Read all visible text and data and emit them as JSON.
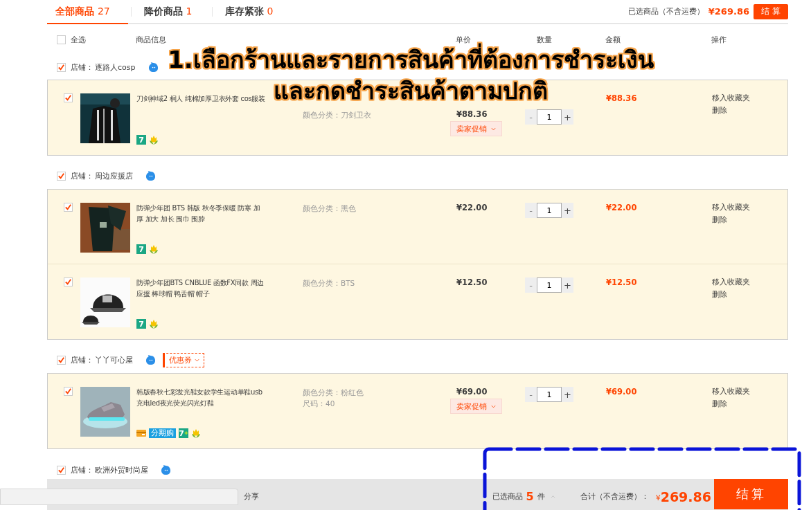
{
  "tabs": [
    {
      "label": "全部商品",
      "count": "27",
      "selected": true
    },
    {
      "label": "降价商品",
      "count": "1",
      "selected": false
    },
    {
      "label": "库存紧张",
      "count": "0",
      "selected": false
    }
  ],
  "top_summary": {
    "label": "已选商品（不含运费）",
    "total": "¥269.86",
    "button": "结 算"
  },
  "header": {
    "select_all": {
      "label": "全选",
      "checked": false
    },
    "columns": [
      "商品信息",
      "单价",
      "数量",
      "金额",
      "操作"
    ]
  },
  "shops": [
    {
      "label": "店铺：",
      "name": "逐路人cosp",
      "checked": true,
      "items": [
        {
          "checked": true,
          "title": "刀剑神域2 桐人 纯棉加厚卫衣外套 cos服装",
          "props": [
            "颜色分类：刀剑卫衣"
          ],
          "price": "¥88.36",
          "promo": "卖家促销",
          "qty": {
            "minus": "-",
            "value": "1",
            "plus": "+"
          },
          "amount": "¥88.36",
          "actions": [
            "移入收藏夹",
            "删除"
          ],
          "badges": [
            {
              "kind": "seven",
              "text": "7"
            },
            {
              "kind": "flower"
            }
          ]
        }
      ]
    },
    {
      "label": "店铺：",
      "name": "周边应援店",
      "checked": true,
      "items": [
        {
          "checked": true,
          "title": "防弹少年团 BTS 韩版 秋冬季保暖 防寒 加厚 加大 加长 围巾 围脖",
          "props": [
            "颜色分类：黑色"
          ],
          "price": "¥22.00",
          "qty": {
            "minus": "-",
            "value": "1",
            "plus": "+"
          },
          "amount": "¥22.00",
          "actions": [
            "移入收藏夹",
            "删除"
          ],
          "badges": [
            {
              "kind": "seven",
              "text": "7"
            },
            {
              "kind": "flower"
            }
          ]
        },
        {
          "checked": true,
          "title": "防弹少年团BTS CNBLUE 函数FX同款 周边应援 棒球帽 鸭舌帽 帽子",
          "props": [
            "颜色分类：BTS"
          ],
          "price": "¥12.50",
          "qty": {
            "minus": "-",
            "value": "1",
            "plus": "+"
          },
          "amount": "¥12.50",
          "actions": [
            "移入收藏夹",
            "删除"
          ],
          "badges": [
            {
              "kind": "seven",
              "text": "7"
            },
            {
              "kind": "flower"
            }
          ]
        }
      ]
    },
    {
      "label": "店铺：",
      "name": "丫丫可心屋",
      "checked": true,
      "coupon": "优惠券",
      "items": [
        {
          "checked": true,
          "title": "韩版春秋七彩发光鞋女款学生运动单鞋usb充电led夜光荧光闪光灯鞋",
          "props": [
            "颜色分类：粉红色",
            "尺码：40"
          ],
          "price": "¥69.00",
          "promo": "卖家促销",
          "qty": {
            "minus": "-",
            "value": "1",
            "plus": "+"
          },
          "amount": "¥69.00",
          "actions": [
            "移入收藏夹",
            "删除"
          ],
          "badges": [
            {
              "kind": "card"
            },
            {
              "kind": "installment",
              "text": "分期购"
            },
            {
              "kind": "seven_plus",
              "text": "7",
              "mark": "+"
            },
            {
              "kind": "flower"
            }
          ]
        }
      ]
    },
    {
      "label": "店铺：",
      "name": "欧洲外贸时尚屋",
      "checked": true
    }
  ],
  "bottom_bar": {
    "links": [
      "分享"
    ],
    "selected_label": "已选商品",
    "selected_count": "5",
    "selected_unit": "件",
    "total_label": "合计（不含运费）：",
    "currency": "¥",
    "total": "269.86",
    "button": "结算"
  },
  "annotation": {
    "lines": [
      "1.เลือกร้านและรายการสินค้าที่ต้องการชำระเงิน",
      "และกดชำระสินค้าตามปกติ"
    ]
  }
}
